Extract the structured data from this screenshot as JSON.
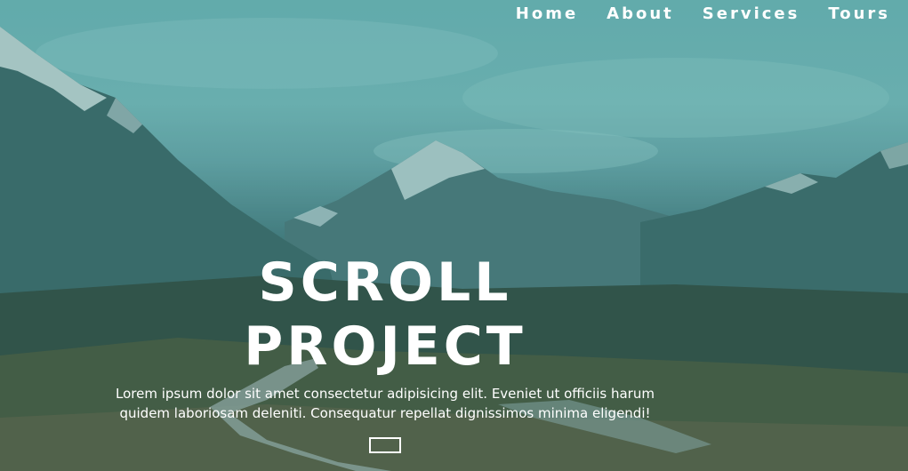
{
  "nav": {
    "items": [
      {
        "label": "Home"
      },
      {
        "label": "About"
      },
      {
        "label": "Services"
      },
      {
        "label": "Tours"
      }
    ]
  },
  "banner": {
    "title": "SCROLL PROJECT",
    "text": "Lorem ipsum dolor sit amet consectetur adipisicing elit. Eveniet ut officiis harum quidem laboriosam deleniti. Consequatur repellat dignissimos minima eligendi!",
    "button_label": ""
  },
  "colors": {
    "sky": "#78b6b6",
    "mountain": "#2f5654",
    "overlay": "#288c8c",
    "text": "#ffffff"
  }
}
